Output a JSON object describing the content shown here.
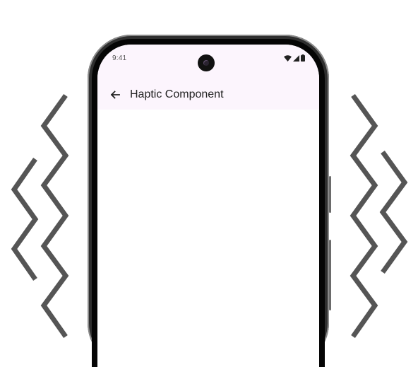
{
  "status_bar": {
    "time": "9:41",
    "icons": [
      "wifi-icon",
      "cellular-signal-icon",
      "battery-icon"
    ]
  },
  "app_bar": {
    "back_icon": "arrow-left-icon",
    "title": "Haptic Component"
  },
  "decoration": {
    "vibration_color": "#555555",
    "app_bar_color": "#fcf5fd"
  }
}
